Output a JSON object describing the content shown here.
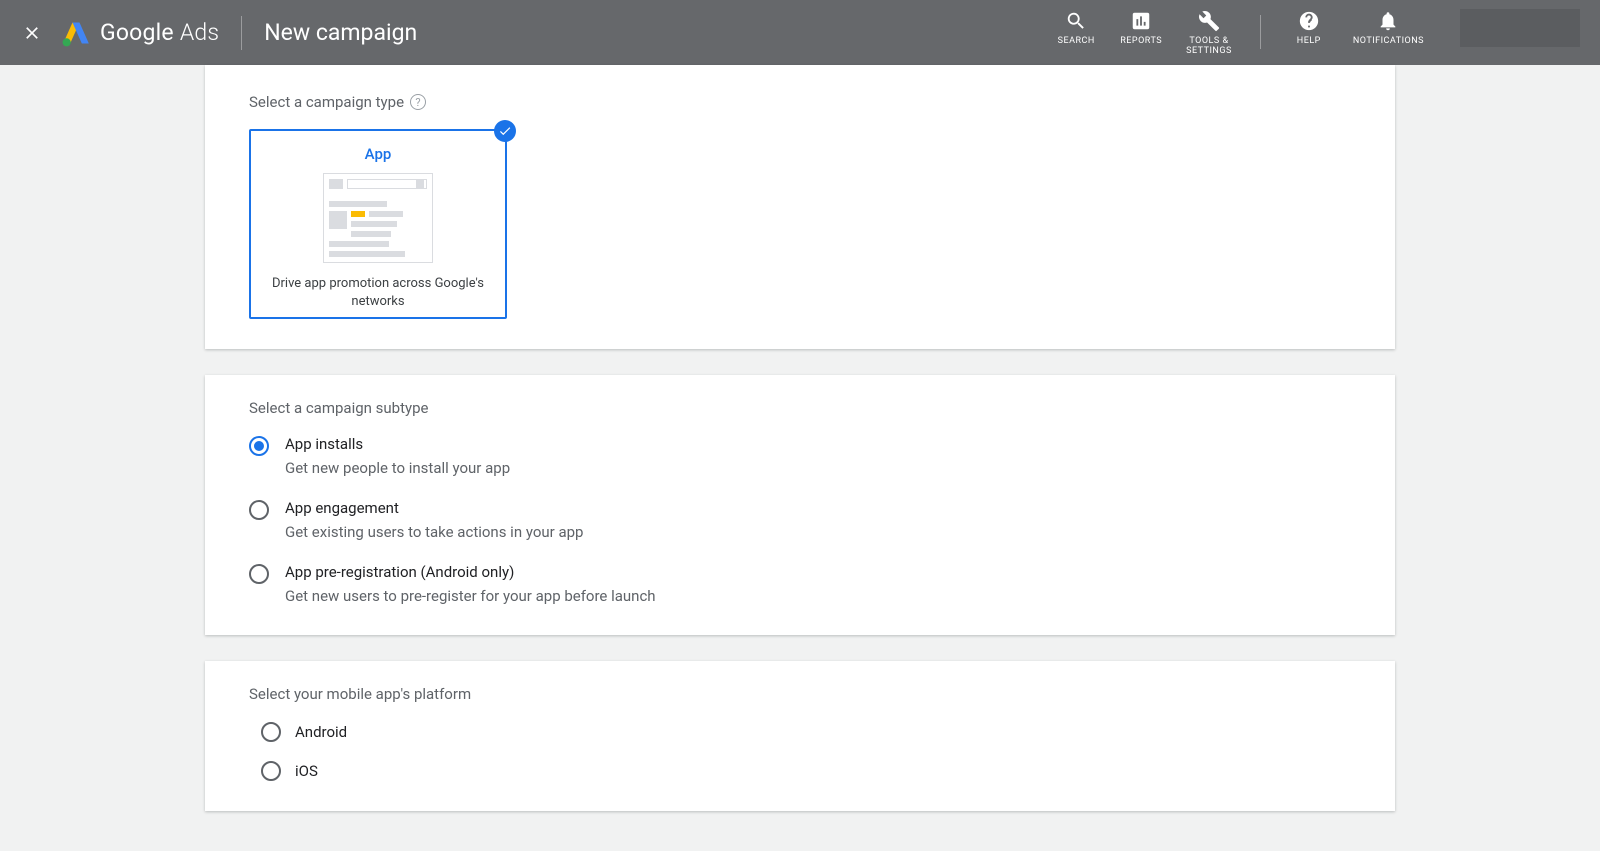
{
  "header": {
    "brand1": "Google",
    "brand2": "Ads",
    "page_title": "New campaign",
    "actions": {
      "search": "SEARCH",
      "reports": "REPORTS",
      "tools": "TOOLS &\nSETTINGS",
      "help": "HELP",
      "notifications": "NOTIFICATIONS"
    }
  },
  "campaign_type": {
    "section_label": "Select a campaign type",
    "card_title": "App",
    "card_desc": "Drive app promotion across Google's networks",
    "selected": true
  },
  "subtype": {
    "section_label": "Select a campaign subtype",
    "options": [
      {
        "title": "App installs",
        "desc": "Get new people to install your app",
        "checked": true
      },
      {
        "title": "App engagement",
        "desc": "Get existing users to take actions in your app",
        "checked": false
      },
      {
        "title": "App pre-registration (Android only)",
        "desc": "Get new users to pre-register for your app before launch",
        "checked": false
      }
    ]
  },
  "platform": {
    "section_label": "Select your mobile app's platform",
    "options": [
      {
        "label": "Android",
        "checked": false
      },
      {
        "label": "iOS",
        "checked": false
      }
    ]
  }
}
